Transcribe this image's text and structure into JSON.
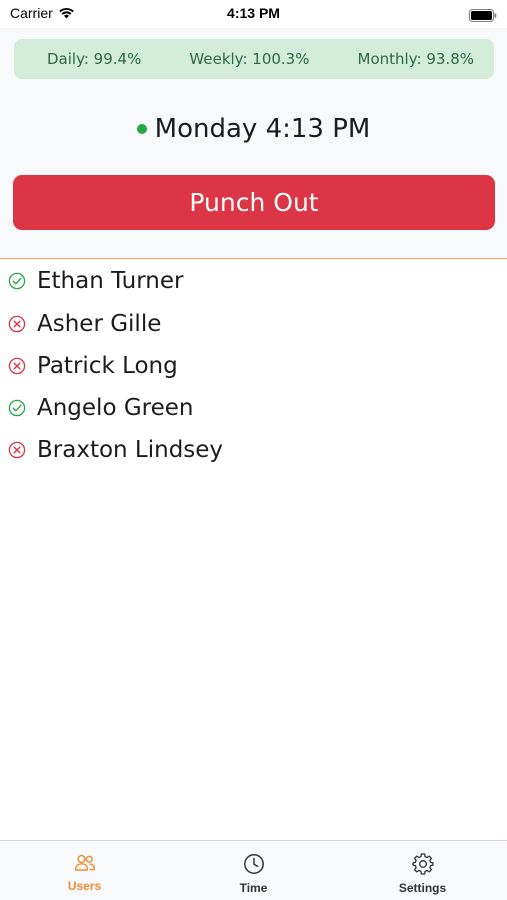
{
  "status_bar": {
    "carrier": "Carrier",
    "time": "4:13 PM"
  },
  "stats": {
    "daily": "Daily: 99.4%",
    "weekly": "Weekly: 100.3%",
    "monthly": "Monthly: 93.8%"
  },
  "clock": {
    "status_color": "#28a745",
    "text": "Monday 4:13 PM"
  },
  "punch_button": {
    "label": "Punch Out",
    "color": "#dc3545"
  },
  "users": [
    {
      "name": "Ethan Turner",
      "status": "present",
      "icon": "check-circle-icon"
    },
    {
      "name": "Asher Gille",
      "status": "absent",
      "icon": "x-circle-icon"
    },
    {
      "name": "Patrick Long",
      "status": "absent",
      "icon": "x-circle-icon"
    },
    {
      "name": "Angelo Green",
      "status": "present",
      "icon": "check-circle-icon"
    },
    {
      "name": "Braxton Lindsey",
      "status": "absent",
      "icon": "x-circle-icon"
    }
  ],
  "tabs": [
    {
      "label": "Users",
      "icon": "users-icon",
      "active": true
    },
    {
      "label": "Time",
      "icon": "clock-icon",
      "active": false
    },
    {
      "label": "Settings",
      "icon": "gear-icon",
      "active": false
    }
  ],
  "colors": {
    "accent": "#f08c32",
    "present": "#28a745",
    "absent": "#dc3545",
    "stats_bg": "#d4edda"
  }
}
